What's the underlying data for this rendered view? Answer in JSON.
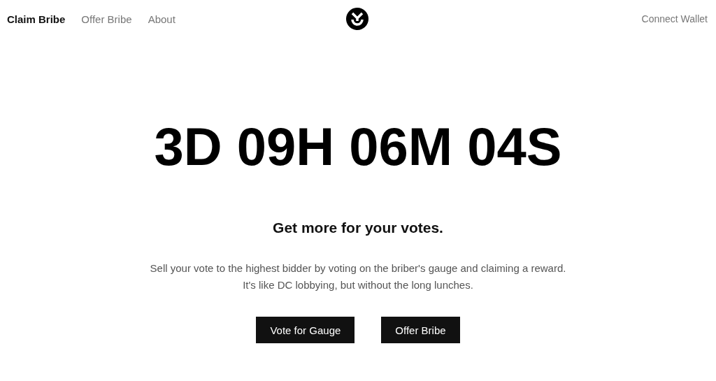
{
  "nav": {
    "links": [
      {
        "label": "Claim Bribe",
        "selected": true
      },
      {
        "label": "Offer Bribe",
        "selected": false
      },
      {
        "label": "About",
        "selected": false
      }
    ],
    "connect": "Connect Wallet"
  },
  "countdown": "3D 09H 06M 04S",
  "headline": "Get more for your votes.",
  "description": [
    "Sell your vote to the highest bidder by voting on the briber's gauge and claiming a reward.",
    "It's like DC lobbying, but without the long lunches."
  ],
  "buttons": [
    "Vote for Gauge",
    "Offer Bribe"
  ]
}
